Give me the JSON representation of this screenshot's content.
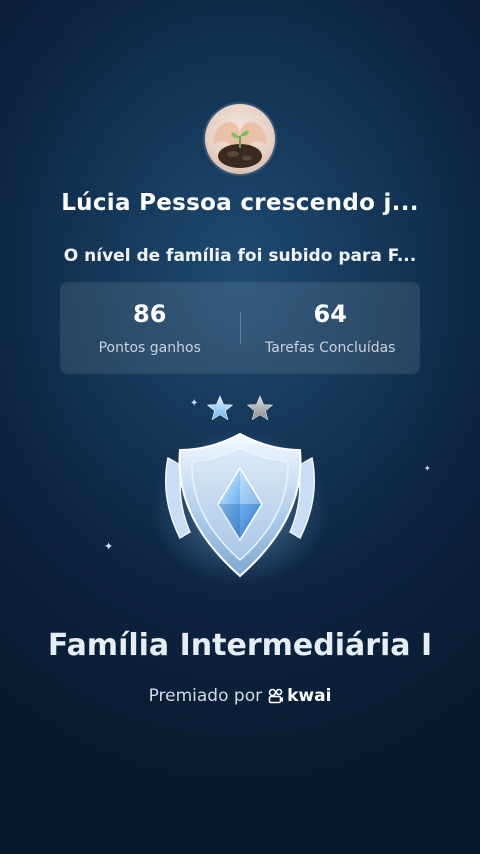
{
  "user": {
    "avatar_icon": "heart-hands-sprout-icon",
    "title": "Lúcia Pessoa crescendo j...",
    "message": "O nível de família foi subido para F..."
  },
  "stats": [
    {
      "value": "86",
      "label": "Pontos ganhos"
    },
    {
      "value": "64",
      "label": "Tarefas Concluídas"
    }
  ],
  "rating": {
    "stars_filled": 1,
    "stars_total": 2
  },
  "badge": {
    "icon": "shield-crystal-badge-icon",
    "title": "Família Intermediária I"
  },
  "awarded": {
    "prefix": "Premiado por",
    "brand": "kwai",
    "brand_icon": "kwai-logo-icon"
  },
  "colors": {
    "background": "#0c2340",
    "accent": "#a9d4ff"
  }
}
